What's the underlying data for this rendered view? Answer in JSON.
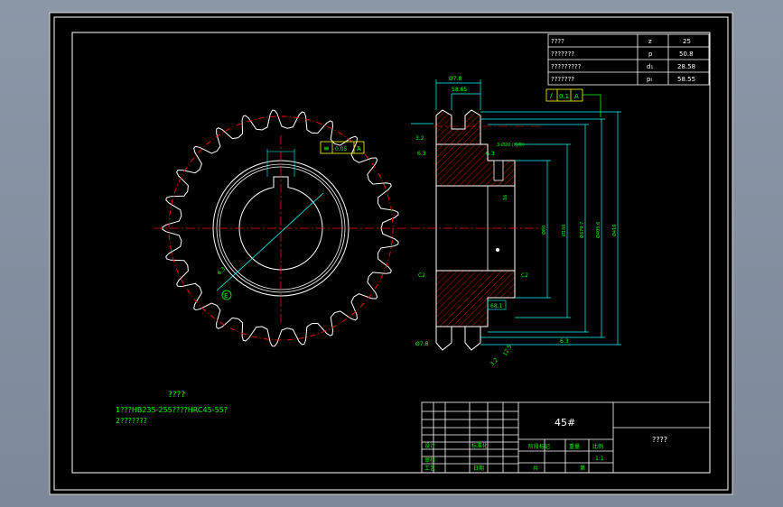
{
  "param_table": {
    "rows": [
      {
        "name": "????",
        "symbol": "z",
        "value": "25"
      },
      {
        "name": "???????",
        "symbol": "p",
        "value": "50.8"
      },
      {
        "name": "?????????",
        "symbol": "d₁",
        "value": "28.58"
      },
      {
        "name": "???????",
        "symbol": "pₜ",
        "value": "58.55"
      }
    ]
  },
  "tolerance_frame_right": {
    "symbol": "/",
    "value": "0.1",
    "datum": "A"
  },
  "tolerance_frame_left": {
    "symbol": "≡",
    "value": "0.05",
    "datum": "A"
  },
  "datum_label": "E",
  "roughness_values": [
    "6.3",
    "3.2",
    "6.3",
    "12.5"
  ],
  "section_dims": {
    "top_h": "Ø7.8",
    "left_top": "58.65",
    "right_top": "Ø7.8",
    "keyway": "3-Ø20 (均布)",
    "key_width": "16",
    "left_chamfer": "C2",
    "right_chamfer": "C2",
    "bore": "68.1",
    "bottom_small": "Ø7.8",
    "v_dims": [
      "Ø80",
      "Ø160",
      "Ø379.7",
      "Ø405.6",
      "Ø416"
    ]
  },
  "notes": {
    "heading": "????",
    "line1": "1???HB235-255????HRC45-55?",
    "line2": "2???????"
  },
  "title_block": {
    "material": "45#",
    "drawing_name": "????",
    "small_labels": [
      "设计",
      "标准化",
      "审核",
      "工艺",
      "日期"
    ],
    "weight_label": "重量",
    "scale_label": "比例",
    "stage_label": "阶段标记",
    "scale_value": "1:1",
    "sheet_total": "共",
    "sheet_no": "第"
  }
}
